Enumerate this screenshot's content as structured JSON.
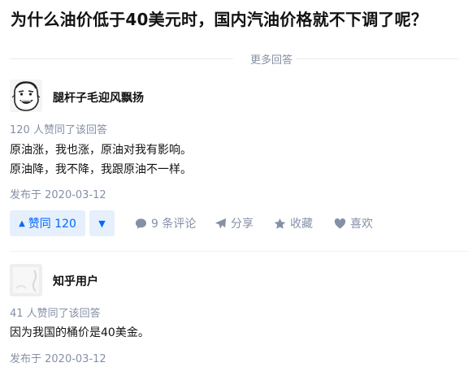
{
  "question": {
    "title": "为什么油价低于40美元时，国内汽油价格就不下调了呢？"
  },
  "more_answers_label": "更多回答",
  "answers": [
    {
      "author": "腿杆子毛迎风飘扬",
      "votes_text": "120 人赞同了该回答",
      "lines": [
        "原油涨，我也涨，原油对我有影响。",
        "原油降，我不降，我跟原油不一样。"
      ],
      "date": "发布于 2020-03-12",
      "vote_label": "赞同 120",
      "actions": {
        "comment": "9 条评论",
        "share": "分享",
        "collect": "收藏",
        "like": "喜欢"
      },
      "avatar_icon": "meme-face-avatar"
    },
    {
      "author": "知乎用户",
      "votes_text": "41 人赞同了该回答",
      "lines": [
        "因为我国的桶价是40美金。"
      ],
      "date": "发布于 2020-03-12",
      "avatar_icon": "default-user-avatar"
    }
  ],
  "colors": {
    "accent": "#0066ff",
    "accent_bg": "#e5f0fc",
    "meta": "#8590a6",
    "text": "#121212"
  }
}
